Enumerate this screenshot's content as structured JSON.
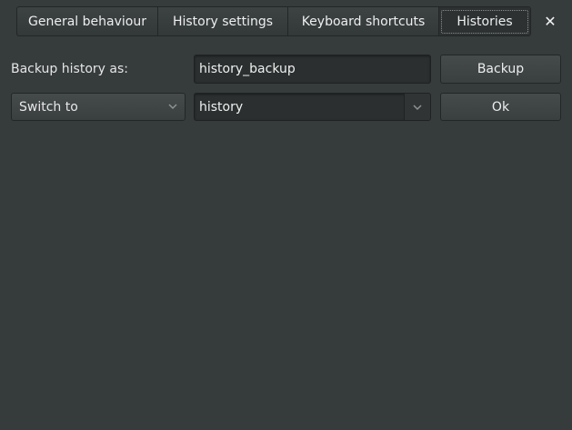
{
  "tabs": [
    {
      "label": "General behaviour",
      "active": false
    },
    {
      "label": "History settings",
      "active": false
    },
    {
      "label": "Keyboard shortcuts",
      "active": false
    },
    {
      "label": "Histories",
      "active": true
    }
  ],
  "close_icon": "✕",
  "backup": {
    "label": "Backup history as:",
    "value": "history_backup",
    "button_label": "Backup"
  },
  "switch": {
    "mode_selected": "Switch to",
    "history_value": "history",
    "button_label": "Ok"
  },
  "icons": {
    "close": "close-icon",
    "combo_arrow": "chevron-down-icon"
  }
}
